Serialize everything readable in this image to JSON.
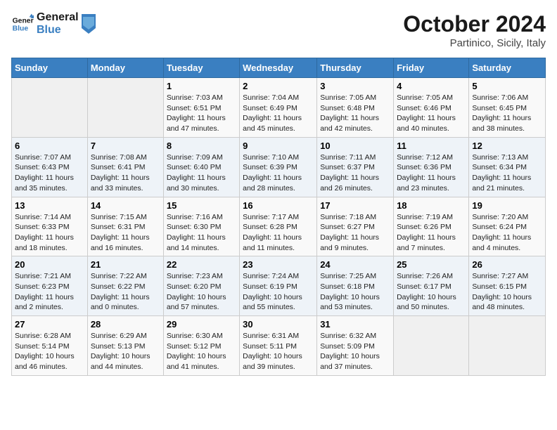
{
  "header": {
    "logo_line1": "General",
    "logo_line2": "Blue",
    "month": "October 2024",
    "location": "Partinico, Sicily, Italy"
  },
  "days_of_week": [
    "Sunday",
    "Monday",
    "Tuesday",
    "Wednesday",
    "Thursday",
    "Friday",
    "Saturday"
  ],
  "weeks": [
    [
      {
        "num": "",
        "info": ""
      },
      {
        "num": "",
        "info": ""
      },
      {
        "num": "1",
        "info": "Sunrise: 7:03 AM\nSunset: 6:51 PM\nDaylight: 11 hours and 47 minutes."
      },
      {
        "num": "2",
        "info": "Sunrise: 7:04 AM\nSunset: 6:49 PM\nDaylight: 11 hours and 45 minutes."
      },
      {
        "num": "3",
        "info": "Sunrise: 7:05 AM\nSunset: 6:48 PM\nDaylight: 11 hours and 42 minutes."
      },
      {
        "num": "4",
        "info": "Sunrise: 7:05 AM\nSunset: 6:46 PM\nDaylight: 11 hours and 40 minutes."
      },
      {
        "num": "5",
        "info": "Sunrise: 7:06 AM\nSunset: 6:45 PM\nDaylight: 11 hours and 38 minutes."
      }
    ],
    [
      {
        "num": "6",
        "info": "Sunrise: 7:07 AM\nSunset: 6:43 PM\nDaylight: 11 hours and 35 minutes."
      },
      {
        "num": "7",
        "info": "Sunrise: 7:08 AM\nSunset: 6:41 PM\nDaylight: 11 hours and 33 minutes."
      },
      {
        "num": "8",
        "info": "Sunrise: 7:09 AM\nSunset: 6:40 PM\nDaylight: 11 hours and 30 minutes."
      },
      {
        "num": "9",
        "info": "Sunrise: 7:10 AM\nSunset: 6:39 PM\nDaylight: 11 hours and 28 minutes."
      },
      {
        "num": "10",
        "info": "Sunrise: 7:11 AM\nSunset: 6:37 PM\nDaylight: 11 hours and 26 minutes."
      },
      {
        "num": "11",
        "info": "Sunrise: 7:12 AM\nSunset: 6:36 PM\nDaylight: 11 hours and 23 minutes."
      },
      {
        "num": "12",
        "info": "Sunrise: 7:13 AM\nSunset: 6:34 PM\nDaylight: 11 hours and 21 minutes."
      }
    ],
    [
      {
        "num": "13",
        "info": "Sunrise: 7:14 AM\nSunset: 6:33 PM\nDaylight: 11 hours and 18 minutes."
      },
      {
        "num": "14",
        "info": "Sunrise: 7:15 AM\nSunset: 6:31 PM\nDaylight: 11 hours and 16 minutes."
      },
      {
        "num": "15",
        "info": "Sunrise: 7:16 AM\nSunset: 6:30 PM\nDaylight: 11 hours and 14 minutes."
      },
      {
        "num": "16",
        "info": "Sunrise: 7:17 AM\nSunset: 6:28 PM\nDaylight: 11 hours and 11 minutes."
      },
      {
        "num": "17",
        "info": "Sunrise: 7:18 AM\nSunset: 6:27 PM\nDaylight: 11 hours and 9 minutes."
      },
      {
        "num": "18",
        "info": "Sunrise: 7:19 AM\nSunset: 6:26 PM\nDaylight: 11 hours and 7 minutes."
      },
      {
        "num": "19",
        "info": "Sunrise: 7:20 AM\nSunset: 6:24 PM\nDaylight: 11 hours and 4 minutes."
      }
    ],
    [
      {
        "num": "20",
        "info": "Sunrise: 7:21 AM\nSunset: 6:23 PM\nDaylight: 11 hours and 2 minutes."
      },
      {
        "num": "21",
        "info": "Sunrise: 7:22 AM\nSunset: 6:22 PM\nDaylight: 11 hours and 0 minutes."
      },
      {
        "num": "22",
        "info": "Sunrise: 7:23 AM\nSunset: 6:20 PM\nDaylight: 10 hours and 57 minutes."
      },
      {
        "num": "23",
        "info": "Sunrise: 7:24 AM\nSunset: 6:19 PM\nDaylight: 10 hours and 55 minutes."
      },
      {
        "num": "24",
        "info": "Sunrise: 7:25 AM\nSunset: 6:18 PM\nDaylight: 10 hours and 53 minutes."
      },
      {
        "num": "25",
        "info": "Sunrise: 7:26 AM\nSunset: 6:17 PM\nDaylight: 10 hours and 50 minutes."
      },
      {
        "num": "26",
        "info": "Sunrise: 7:27 AM\nSunset: 6:15 PM\nDaylight: 10 hours and 48 minutes."
      }
    ],
    [
      {
        "num": "27",
        "info": "Sunrise: 6:28 AM\nSunset: 5:14 PM\nDaylight: 10 hours and 46 minutes."
      },
      {
        "num": "28",
        "info": "Sunrise: 6:29 AM\nSunset: 5:13 PM\nDaylight: 10 hours and 44 minutes."
      },
      {
        "num": "29",
        "info": "Sunrise: 6:30 AM\nSunset: 5:12 PM\nDaylight: 10 hours and 41 minutes."
      },
      {
        "num": "30",
        "info": "Sunrise: 6:31 AM\nSunset: 5:11 PM\nDaylight: 10 hours and 39 minutes."
      },
      {
        "num": "31",
        "info": "Sunrise: 6:32 AM\nSunset: 5:09 PM\nDaylight: 10 hours and 37 minutes."
      },
      {
        "num": "",
        "info": ""
      },
      {
        "num": "",
        "info": ""
      }
    ]
  ]
}
